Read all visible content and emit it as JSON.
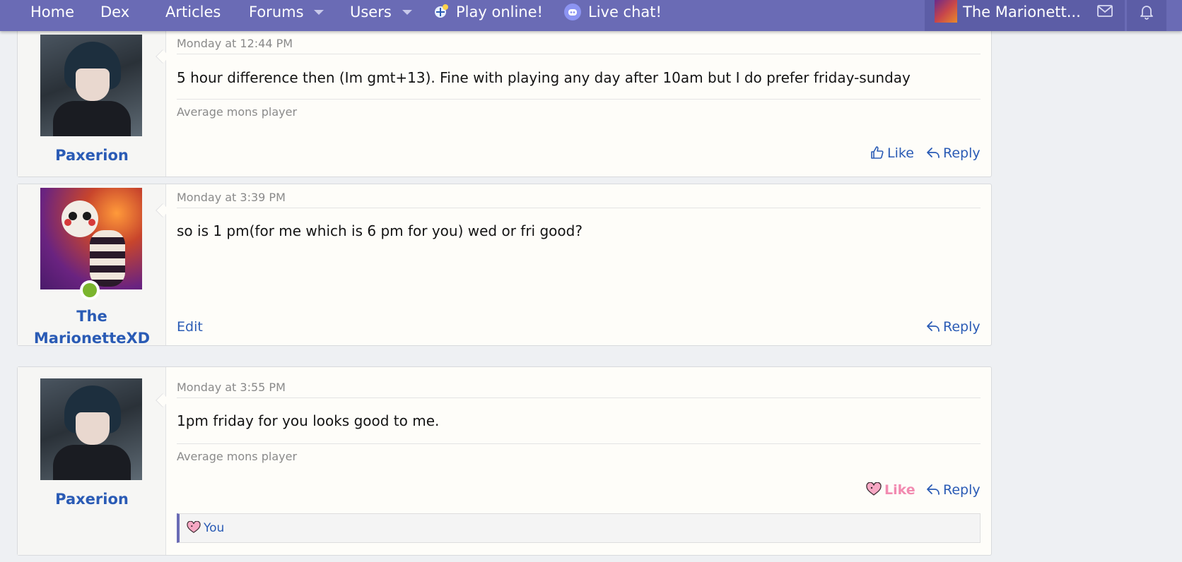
{
  "nav": {
    "home": "Home",
    "dex": "Dex",
    "articles": "Articles",
    "forums": "Forums",
    "users": "Users",
    "play_online": "Play online!",
    "live_chat": "Live chat!",
    "account_name": "The Marionett...",
    "accent_color": "#6a6bb5"
  },
  "posts": [
    {
      "username": "Paxerion",
      "date": "Monday at 12:44 PM",
      "text": "5 hour difference then (Im gmt+13). Fine with playing any day after 10am but I do prefer friday-sunday",
      "signature": "Average mons player",
      "like_label": "Like",
      "reply_label": "Reply"
    },
    {
      "username_line1": "The",
      "username_line2": "MarionetteXD",
      "date": "Monday at 3:39 PM",
      "text": "so is 1 pm(for me which is 6 pm for you) wed or fri good?",
      "edit_label": "Edit",
      "reply_label": "Reply",
      "online": true
    },
    {
      "username": "Paxerion",
      "date": "Monday at 3:55 PM",
      "text": "1pm friday for you looks good to me.",
      "signature": "Average mons player",
      "like_label": "Like",
      "like_state": "liked",
      "reply_label": "Reply",
      "reaction_by": "You"
    }
  ]
}
